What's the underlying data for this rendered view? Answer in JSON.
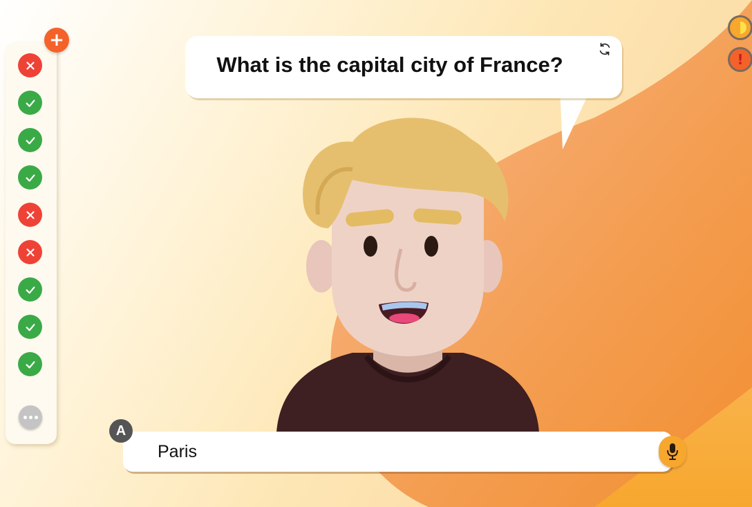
{
  "question": {
    "text": "What is the capital city of France?"
  },
  "answer": {
    "badge_letter": "A",
    "value": "Paris"
  },
  "results": [
    "wrong",
    "correct",
    "correct",
    "correct",
    "wrong",
    "wrong",
    "correct",
    "correct",
    "correct"
  ],
  "icons": {
    "add": "plus-icon",
    "refresh": "refresh-icon",
    "theme": "theme-icon",
    "report": "alert-icon",
    "mic": "microphone-icon",
    "more": "more-icon"
  },
  "colors": {
    "correct": "#3aaa47",
    "wrong": "#ef4236",
    "accent": "#f4622a",
    "orange": "#f7a72e"
  }
}
